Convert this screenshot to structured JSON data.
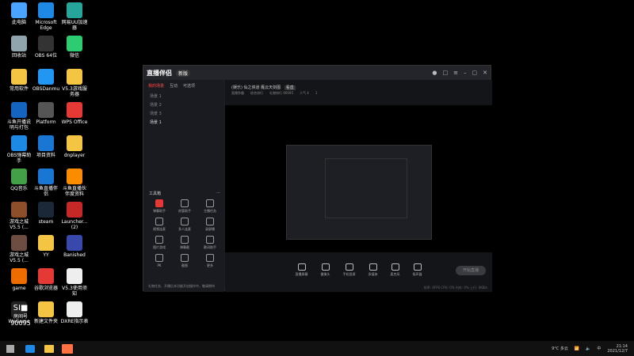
{
  "desktop": {
    "icons": [
      {
        "label": "此电脑",
        "color": "#4aa3ff"
      },
      {
        "label": "Microsoft\nEdge",
        "color": "#1e88e5"
      },
      {
        "label": "网易UU加速\n器",
        "color": "#26a69a"
      },
      {
        "label": "回收站",
        "color": "#90a4ae"
      },
      {
        "label": "OBS 64位",
        "color": "#333333"
      },
      {
        "label": "微信",
        "color": "#2ecc71"
      },
      {
        "label": "常用软件",
        "color": "#f4c542"
      },
      {
        "label": "OBSDanmu",
        "color": "#2196f3"
      },
      {
        "label": "V5.3游戏服\n务器",
        "color": "#f4c542"
      },
      {
        "label": "斗鱼开播说\n明与打包",
        "color": "#1565c0"
      },
      {
        "label": "Platform",
        "color": "#555555"
      },
      {
        "label": "WPS Office",
        "color": "#e53935"
      },
      {
        "label": "OBS弹幕助\n手",
        "color": "#1e88e5"
      },
      {
        "label": "项目资料",
        "color": "#1976d2"
      },
      {
        "label": "dnplayer",
        "color": "#f4c542"
      },
      {
        "label": "QQ音乐",
        "color": "#43a047"
      },
      {
        "label": "斗鱼直播伴\n侣",
        "color": "#1976d2"
      },
      {
        "label": "斗鱼直播伙\n伴度资料",
        "color": "#fb8c00"
      },
      {
        "label": "游戏之城\nV5.5 (...",
        "color": "#8d4e2a"
      },
      {
        "label": "steam",
        "color": "#1b2838"
      },
      {
        "label": "Launcher...\n(2)",
        "color": "#c62828"
      },
      {
        "label": "游戏之城\nV5.5 (...",
        "color": "#6d4c41"
      },
      {
        "label": "YY",
        "color": "#f4c542"
      },
      {
        "label": "Banished",
        "color": "#3949ab"
      },
      {
        "label": "game",
        "color": "#ef6c00"
      },
      {
        "label": "谷歌浏览器",
        "color": "#e53935"
      },
      {
        "label": "V5.3使用须\n知",
        "color": "#eeeeee"
      },
      {
        "label": "WeGame",
        "color": "#222222"
      },
      {
        "label": "新建文件夹",
        "color": "#f4c542"
      },
      {
        "label": "DXRE指示表",
        "color": "#eeeeee"
      }
    ]
  },
  "overlay": {
    "big": "SI■",
    "mid": "房间号",
    "num": "90095"
  },
  "app": {
    "logo": "直播伴侣",
    "badge": "新版",
    "title_icons": [
      "avatar-icon",
      "message-icon",
      "minimize-icon",
      "restore-icon",
      "close-icon"
    ],
    "sidebar": {
      "tabs": [
        "我的场景",
        "互动",
        "可选项"
      ],
      "scenes": [
        "场景 1",
        "场景 2",
        "场景 3",
        "场景 1"
      ],
      "tools_title": "工具箱",
      "tools": [
        "弹幕助手",
        "房管助手",
        "主播任务",
        "视频连麦",
        "多人连麦",
        "录屏播",
        "图片游戏",
        "弹幕截",
        "歌词助手",
        "PK",
        "截图",
        "更多"
      ],
      "notice": "礼物任务、开播后本功能开启操作中，敬请期待"
    },
    "room": {
      "title": "(娱乐) 仙之侠道 雁云天剑图",
      "tag": "看直",
      "meta": [
        "直播争霸",
        "综合排行",
        "礼物排行 90095",
        "人气 4",
        "1"
      ]
    },
    "controls": [
      "直播屏幕",
      "摄像头",
      "手机投屏",
      "多媒体",
      "麦克风",
      "扬声器"
    ],
    "live_button": "开始直播",
    "status": "帧率: 0FPS  CPU: 0%  内存: 0%  上行: 0KB/s"
  },
  "taskbar": {
    "weather": "9°C 多云",
    "ime": "中",
    "time": "21:14",
    "date": "2021/12/7"
  }
}
